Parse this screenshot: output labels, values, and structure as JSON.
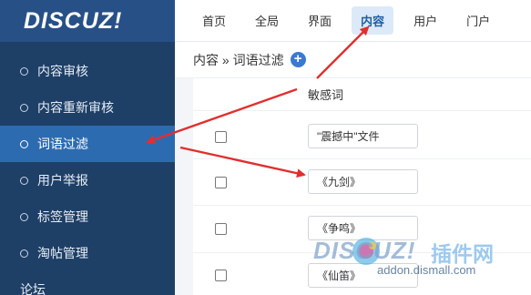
{
  "logo": {
    "text": "DISCUZ!"
  },
  "sidebar": {
    "items": [
      {
        "label": "内容审核"
      },
      {
        "label": "内容重新审核"
      },
      {
        "label": "词语过滤"
      },
      {
        "label": "用户举报"
      },
      {
        "label": "标签管理"
      },
      {
        "label": "淘帖管理"
      }
    ],
    "active_index": 2,
    "section_label": "论坛"
  },
  "topnav": {
    "tabs": [
      "首页",
      "全局",
      "界面",
      "内容",
      "用户",
      "门户"
    ],
    "active_index": 3
  },
  "breadcrumb": {
    "text": "内容 » 词语过滤",
    "add_icon": "plus-circle-icon"
  },
  "table": {
    "header": "敏感词",
    "rows": [
      {
        "word": "\"震撼中\"文件"
      },
      {
        "word": "《九剑》"
      },
      {
        "word": "《争鸣》"
      },
      {
        "word": "《仙笛》"
      }
    ]
  },
  "watermark": {
    "brand": "DISCUZ!",
    "cn": "插件网",
    "url": "addon.dismall.com"
  },
  "colors": {
    "sidebar_bg": "#1e3f66",
    "sidebar_active": "#2d6bb0",
    "tab_active_bg": "#dce9f8",
    "arrow_red": "#e02f2f",
    "add_button": "#3b79d1"
  }
}
